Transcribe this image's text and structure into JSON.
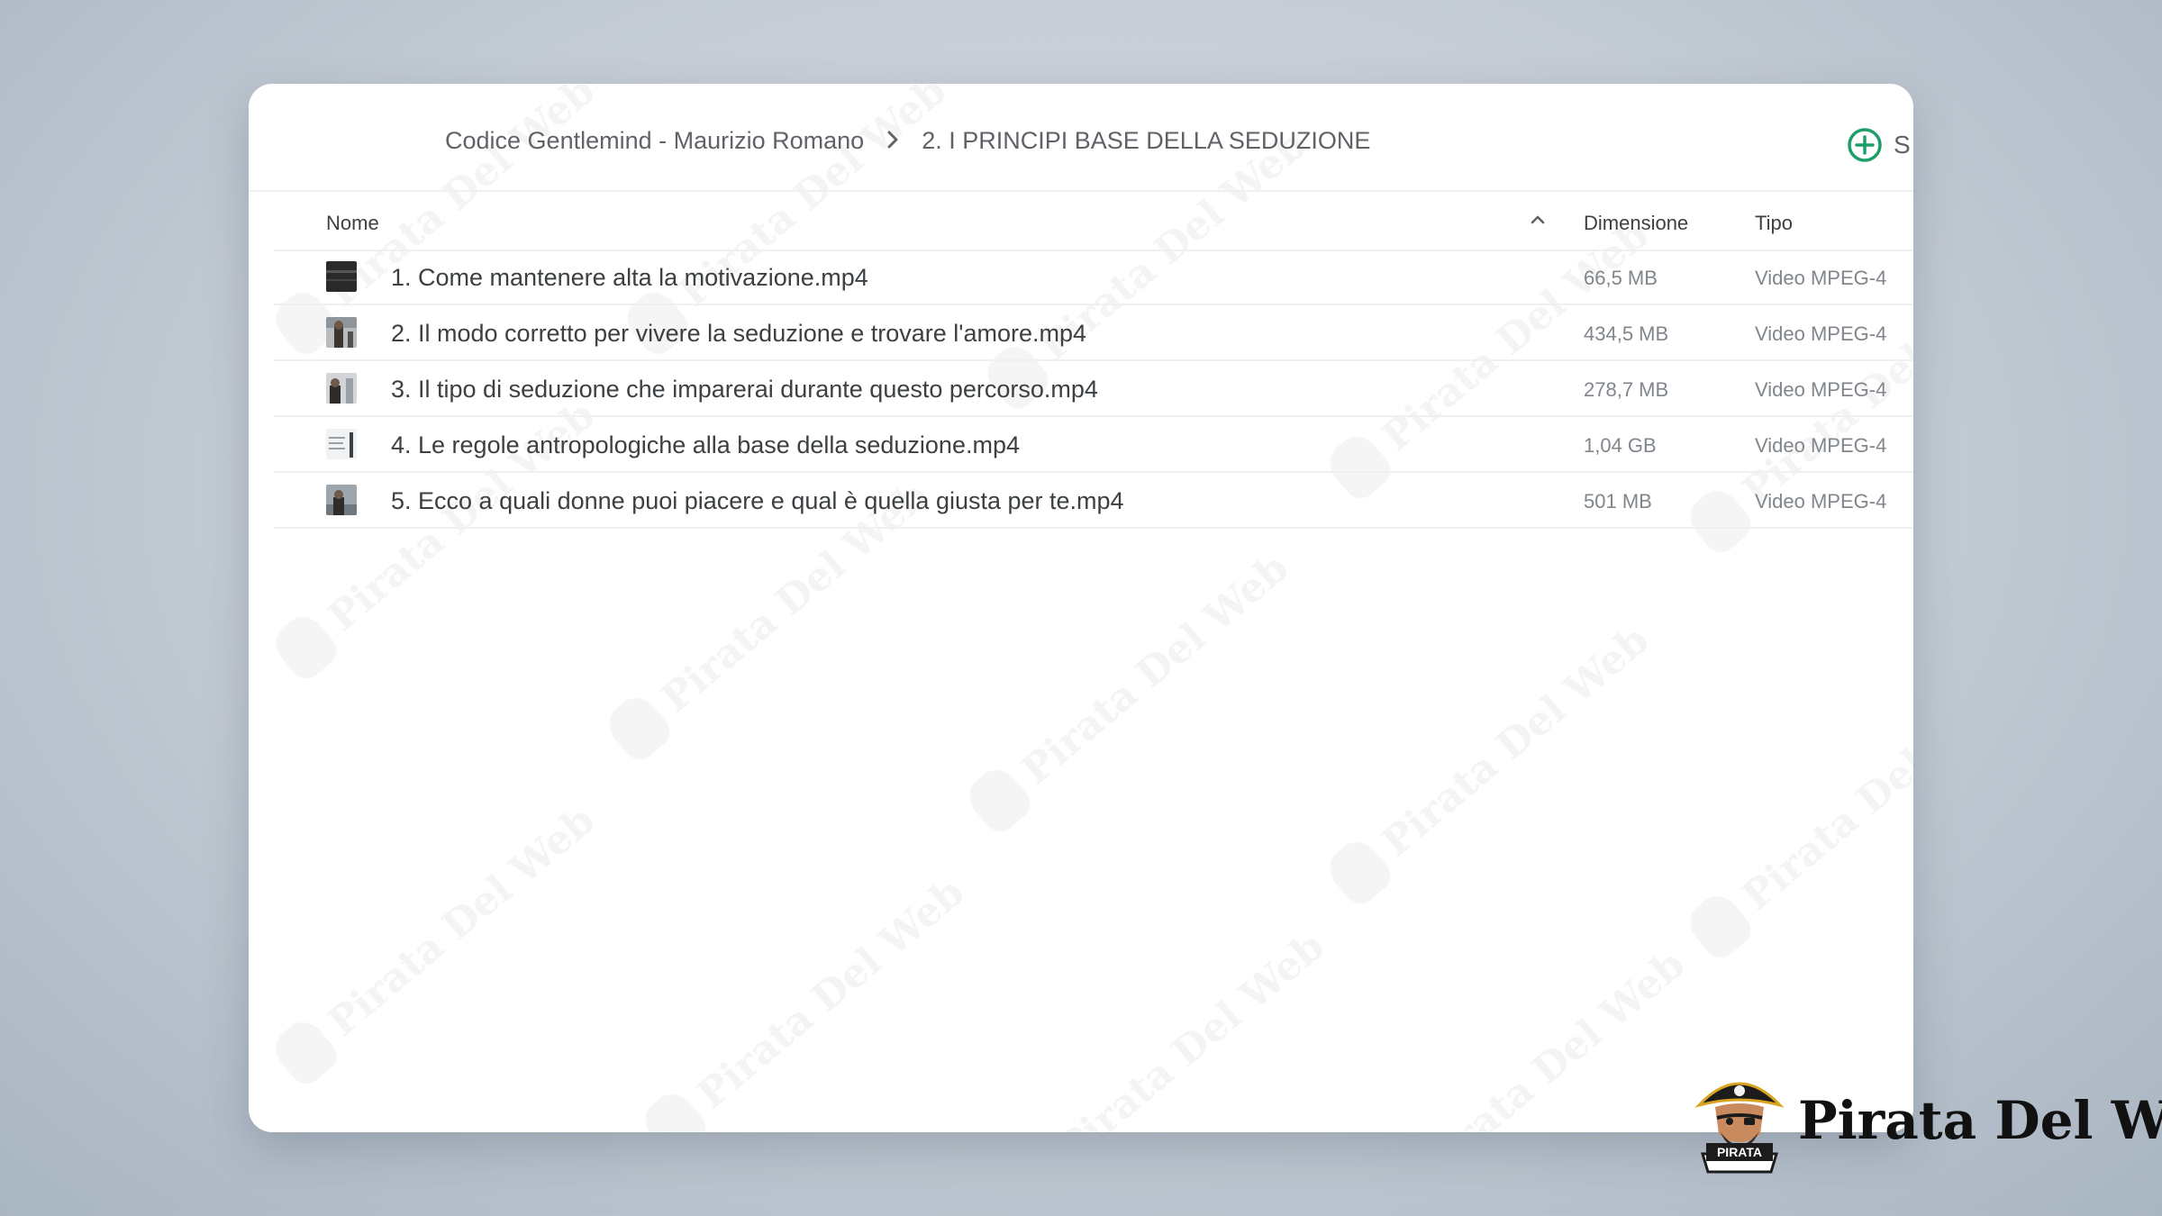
{
  "breadcrumb": {
    "items": [
      {
        "label": "Codice Gentlemind - Maurizio Romano"
      },
      {
        "label": "2. I PRINCIPI BASE DELLA SEDUZIONE"
      }
    ]
  },
  "toolbar": {
    "add_label": "S"
  },
  "table": {
    "columns": {
      "name": "Nome",
      "size": "Dimensione",
      "type": "Tipo"
    },
    "sort": {
      "column": "name",
      "direction": "ascending"
    },
    "rows": [
      {
        "name": "1. Come mantenere alta la motivazione.mp4",
        "size": "66,5 MB",
        "type": "Video MPEG-4"
      },
      {
        "name": "2. Il modo corretto per vivere la seduzione e trovare l'amore.mp4",
        "size": "434,5 MB",
        "type": "Video MPEG-4"
      },
      {
        "name": "3. Il tipo di seduzione che imparerai durante questo percorso.mp4",
        "size": "278,7 MB",
        "type": "Video MPEG-4"
      },
      {
        "name": "4. Le regole antropologiche alla base della seduzione.mp4",
        "size": "1,04 GB",
        "type": "Video MPEG-4"
      },
      {
        "name": "5. Ecco a quali donne puoi piacere e qual è quella giusta per te.mp4",
        "size": "501 MB",
        "type": "Video MPEG-4"
      }
    ]
  },
  "watermark": {
    "text": "Pirata Del Web"
  },
  "logo": {
    "badge": "PIRATA",
    "text": "Pirata Del Web"
  },
  "colors": {
    "accent_green": "#1e9e6a",
    "text_primary": "#3c4043",
    "text_secondary": "#80868b",
    "divider": "#eef0f2"
  },
  "icons": {
    "breadcrumb_separator": "chevron-right-icon",
    "add": "plus-circle-icon",
    "sort": "chevron-up-icon"
  }
}
